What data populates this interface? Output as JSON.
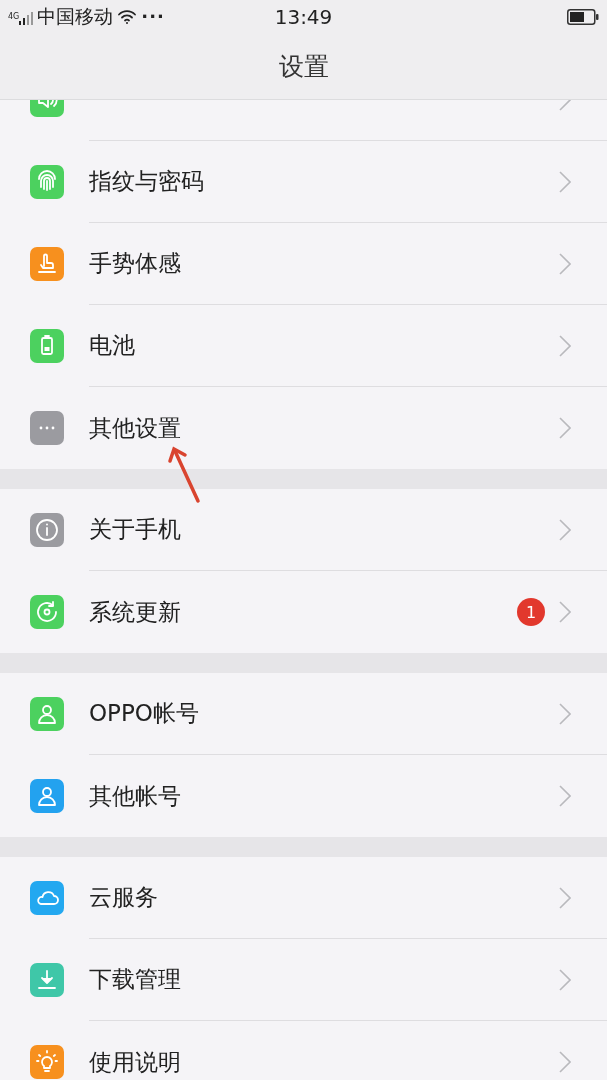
{
  "status_bar": {
    "network": "4G",
    "carrier": "中国移动",
    "more": "···",
    "time": "13:49"
  },
  "header": {
    "title": "设置"
  },
  "groups": [
    {
      "items": [
        {
          "color": "#4cd15f"
        },
        {
          "label": "指纹与密码",
          "color": "#4cd15f"
        },
        {
          "label": "手势体感",
          "color": "#f7901e"
        },
        {
          "label": "电池",
          "color": "#4cd15f"
        },
        {
          "label": "其他设置",
          "color": "#9b9ba0"
        }
      ]
    },
    {
      "items": [
        {
          "label": "关于手机",
          "color": "#9b9ba0"
        },
        {
          "label": "系统更新",
          "color": "#4cd15f",
          "badge": "1"
        }
      ]
    },
    {
      "items": [
        {
          "label": "OPPO帐号",
          "color": "#4cd15f"
        },
        {
          "label": "其他帐号",
          "color": "#23a2ef"
        }
      ]
    },
    {
      "items": [
        {
          "label": "云服务",
          "color": "#23a8f0"
        },
        {
          "label": "下载管理",
          "color": "#3fc7a8"
        },
        {
          "label": "使用说明",
          "color": "#f7901e"
        }
      ]
    }
  ]
}
